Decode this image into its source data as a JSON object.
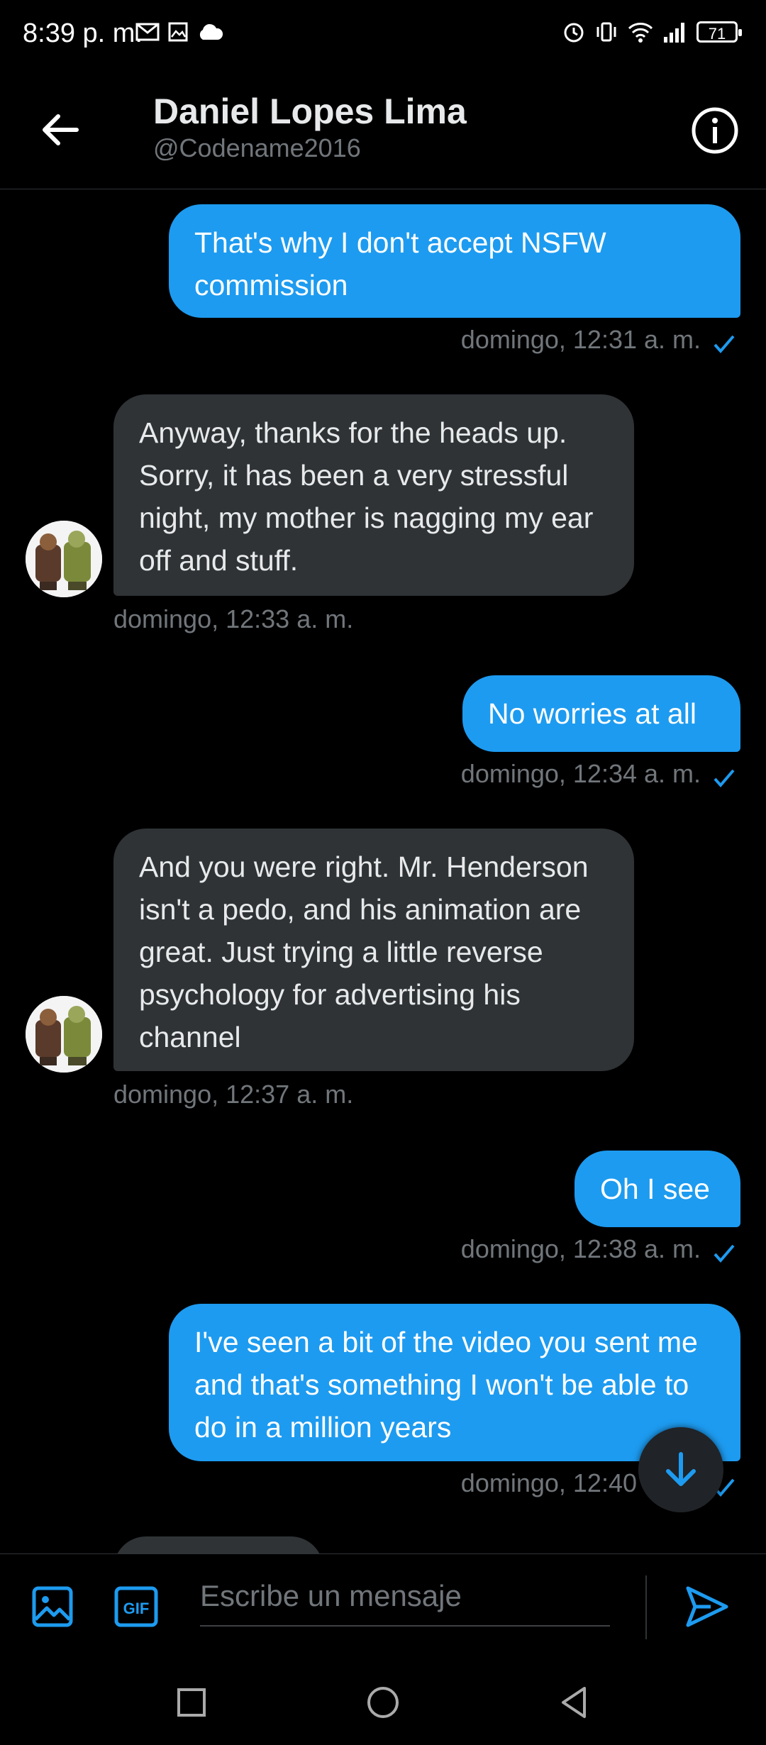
{
  "status_bar": {
    "time": "8:39 p. m.",
    "battery": "71",
    "icons_left": [
      "gmail-icon",
      "gallery-icon",
      "cloud-icon"
    ],
    "icons_right": [
      "alarm-icon",
      "vibrate-icon",
      "wifi-icon",
      "signal-icon",
      "battery-icon"
    ]
  },
  "header": {
    "name": "Daniel Lopes Lima",
    "handle": "@Codename2016"
  },
  "messages": [
    {
      "dir": "out",
      "text": "That's why I don't accept NSFW commission",
      "time": "domingo, 12:31 a. m."
    },
    {
      "dir": "in",
      "text": "Anyway, thanks for the heads up. Sorry, it has been a very stressful night, my mother is nagging my ear off and stuff.",
      "time": "domingo, 12:33 a. m."
    },
    {
      "dir": "out",
      "text": "No worries at all",
      "time": "domingo, 12:34 a. m."
    },
    {
      "dir": "in",
      "text": "And you were right. Mr. Henderson isn't a pedo, and his animation are great. Just trying a little reverse psychology for advertising his channel",
      "time": "domingo, 12:37 a. m."
    },
    {
      "dir": "out",
      "text": "Oh I see",
      "time": "domingo, 12:38 a. m."
    },
    {
      "dir": "out",
      "text": "I've seen a bit of the video you sent me and that's something I won't be able to do in a million years",
      "time": "domingo, 12:40 a. m."
    }
  ],
  "composer": {
    "placeholder": "Escribe un mensaje",
    "gif_label": "GIF"
  },
  "colors": {
    "accent": "#1d9bf0",
    "incoming_bubble": "#2f3336",
    "background": "#000000",
    "muted_text": "#71767b"
  }
}
